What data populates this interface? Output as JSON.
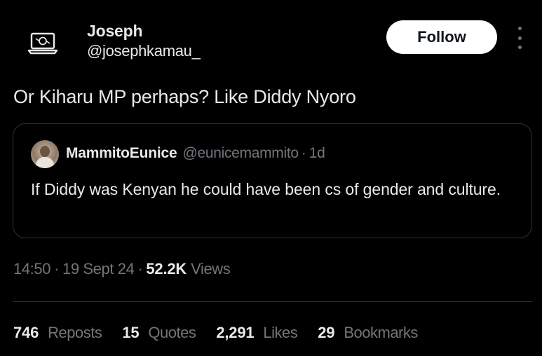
{
  "author": {
    "name": "Joseph",
    "handle": "@josephkamau_",
    "avatar_icon": "laptop-logo-icon"
  },
  "header": {
    "follow_label": "Follow",
    "more_icon": "more-vertical-icon"
  },
  "tweet": {
    "text": "Or Kiharu MP perhaps? Like Diddy Nyoro"
  },
  "quote": {
    "name": "MammitoEunice",
    "handle": "@eunicemammito",
    "dot": "·",
    "time": "1d",
    "text": "If Diddy was Kenyan he could have been cs of gender and culture."
  },
  "meta": {
    "time": "14:50",
    "sep1": "·",
    "date": "19 Sept 24",
    "sep2": "·",
    "views_count": "52.2K",
    "views_label": "Views"
  },
  "stats": {
    "reposts": {
      "count": "746",
      "label": "Reposts"
    },
    "quotes": {
      "count": "15",
      "label": "Quotes"
    },
    "likes": {
      "count": "2,291",
      "label": "Likes"
    },
    "bookmarks": {
      "count": "29",
      "label": "Bookmarks"
    }
  },
  "colors": {
    "background": "#000000",
    "text_primary": "#e7e9ea",
    "text_secondary": "#71767b",
    "border": "#2f3336",
    "follow_bg": "#ffffff",
    "follow_text": "#0f1419"
  }
}
